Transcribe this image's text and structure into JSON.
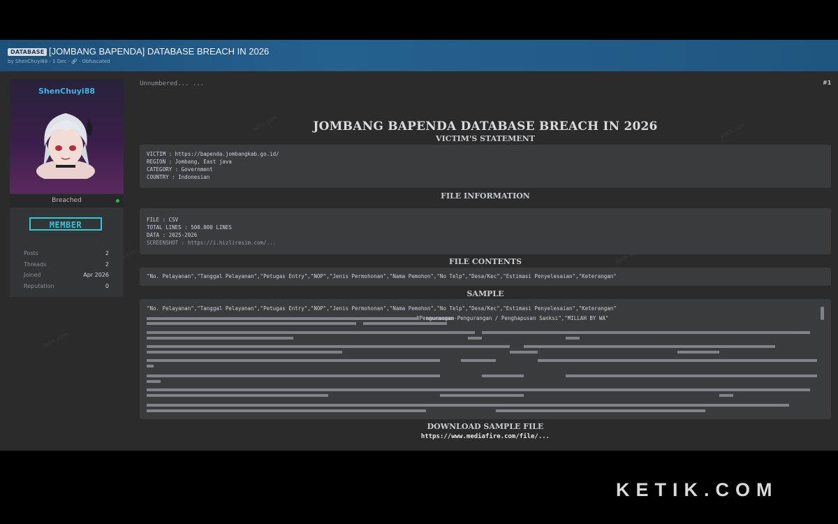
{
  "header": {
    "badge": "DATABASE",
    "title": "[JOMBANG BAPENDA] DATABASE BREACH IN 2026",
    "meta": "by ShenChuyi88 - 1 Dec · 🔗 · Obfuscated"
  },
  "user": {
    "username": "ShenChuyi88",
    "status": "Breached",
    "role": "MEMBER",
    "stats": [
      {
        "label": "Posts",
        "value": "2"
      },
      {
        "label": "Threads",
        "value": "2"
      },
      {
        "label": "Joined",
        "value": "Apr 2026"
      },
      {
        "label": "Reputation",
        "value": "0"
      }
    ],
    "colors": {
      "username": "#3fb7e8",
      "role": "#33c7d9",
      "online": "#3bb54a"
    }
  },
  "post": {
    "number": "#1",
    "head": "Unnumbered...  ...",
    "title": "JOMBANG BAPENDA DATABASE BREACH IN 2026",
    "sections": {
      "victim": "VICTIM'S STATEMENT",
      "file_info": "FILE INFORMATION",
      "contents": "FILE CONTENTS",
      "sample": "SAMPLE",
      "download": "DOWNLOAD SAMPLE FILE"
    },
    "victim": {
      "victim": "VICTIM : https://bapenda.jombangkab.go.id/",
      "region": "REGION : Jombang, East java",
      "category": "CATEGORY : Government",
      "country": "COUNTRY : Indonesian"
    },
    "file_info": {
      "file": "FILE : CSV",
      "lines": "TOTAL LINES : 500.000 LINES",
      "data": "DATA : 2025-2026",
      "screenshot": "SCREENSHOT : https://i.hizliresim.com/..."
    },
    "contents_line": "\"No. Pelayanan\",\"Tanggal Pelayanan\",\"Petugas Entry\",\"NOP\",\"Jenis Permohonan\",\"Nama Pemohon\",\"No Telp\",\"Desa/Kec\",\"Estimasi Penyelesaian\",\"Keterangan\"",
    "sample_header": "\"No. Pelayanan\",\"Tanggal Pelayanan\",\"Petugas Entry\",\"NOP\",\"Jenis Permohonan\",\"Nama Pemohon\",\"No Telp\",\"Desa/Kec\",\"Estimasi Penyelesaian\",\"Keterangan\"",
    "sample_visible": "\"Pengurangan-Pengurangan / Penghapusan Sanksi\",\"MILLAH BY WA\"",
    "download_link": "https://www.mediafire.com/file/..."
  },
  "watermark": "ketik.com",
  "branding": "KETIK.COM"
}
